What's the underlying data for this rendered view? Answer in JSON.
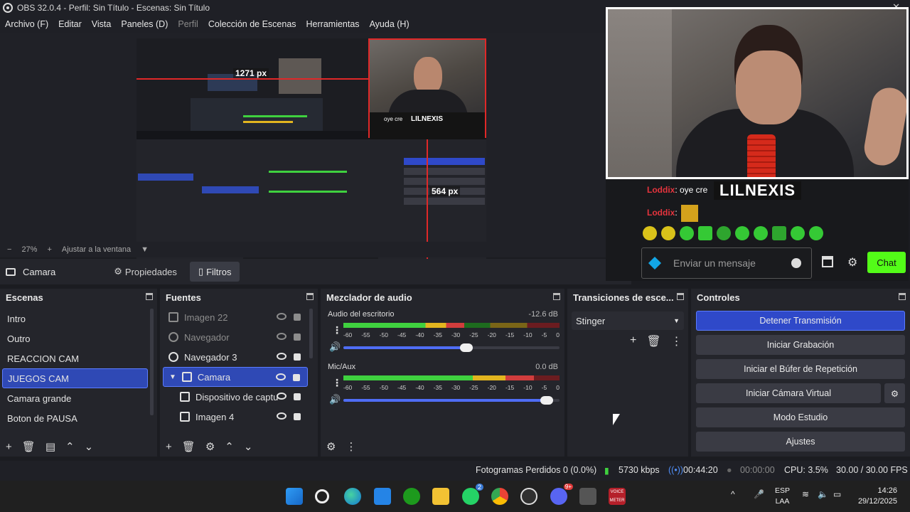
{
  "window": {
    "title": "OBS 32.0.4 - Perfil: Sin Título - Escenas: Sin Título"
  },
  "menu": [
    "Archivo (F)",
    "Editar",
    "Vista",
    "Paneles (D)",
    "Perfil",
    "Colección de Escenas",
    "Herramientas",
    "Ayuda (H)"
  ],
  "preview": {
    "nested_width_label": "1271 px",
    "nested_height_label": "564 px",
    "nested_chat_name": "LILNEXIS",
    "nested_chat_msg": "oye cre"
  },
  "zoom": {
    "minus": "−",
    "value": "27%",
    "plus": "+",
    "fit_label": "Ajustar a la ventana"
  },
  "source_toolbar": {
    "source_name": "Camara",
    "properties_label": "Propiedades",
    "filters_label": "Filtros"
  },
  "overlay": {
    "chat": [
      {
        "user": "Loddix",
        "text": ": oye cre"
      },
      {
        "user": "Loddix",
        "text": ":"
      }
    ],
    "streamer_name": "LILNEXIS",
    "message_placeholder": "Enviar un mensaje",
    "chat_button": "Chat",
    "accent": "#53fc18"
  },
  "scenes": {
    "title": "Escenas",
    "items": [
      "Intro",
      "Outro",
      "REACCION CAM",
      "JUEGOS CAM",
      "Camara grande",
      "Boton de PAUSA"
    ],
    "selected": "JUEGOS CAM"
  },
  "sources": {
    "title": "Fuentes",
    "items": [
      {
        "label": "Imagen 22",
        "icon": "image-icon",
        "visible": false
      },
      {
        "label": "Navegador",
        "icon": "globe-icon",
        "visible": false
      },
      {
        "label": "Navegador 3",
        "icon": "globe-icon",
        "visible": true
      },
      {
        "label": "Camara",
        "icon": "folder-icon",
        "visible": true
      },
      {
        "label": "Dispositivo de captu",
        "icon": "camera-icon",
        "visible": true
      },
      {
        "label": "Imagen 4",
        "icon": "image-icon",
        "visible": true
      }
    ],
    "selected": "Camara"
  },
  "mixer": {
    "title": "Mezclador de audio",
    "scale": [
      "-60",
      "-55",
      "-50",
      "-45",
      "-40",
      "-35",
      "-30",
      "-25",
      "-20",
      "-15",
      "-10",
      "-5",
      "0"
    ],
    "channels": [
      {
        "name": "Audio del escritorio",
        "db": "-12.6 dB",
        "level": 0.56,
        "volume": 0.6
      },
      {
        "name": "Mic/Aux",
        "db": "0.0 dB",
        "level": 0.88,
        "volume": 0.97
      }
    ]
  },
  "transitions": {
    "title": "Transiciones de esce...",
    "selected": "Stinger"
  },
  "controls": {
    "title": "Controles",
    "buttons": [
      "Detener Transmisión",
      "Iniciar Grabación",
      "Iniciar el Búfer de Repetición",
      "Iniciar Cámara Virtual",
      "Modo Estudio",
      "Ajustes"
    ]
  },
  "status": {
    "dropped_frames": "Fotogramas Perdidos 0 (0.0%)",
    "bitrate": "5730 kbps",
    "stream_time": "00:44:20",
    "rec_time": "00:00:00",
    "cpu": "CPU: 3.5%",
    "fps": "30.00 / 30.00 FPS"
  },
  "taskbar": {
    "lang_top": "ESP",
    "lang_bottom": "LAA",
    "time": "14:26",
    "date": "29/12/2025",
    "whatsapp_badge": "2",
    "discord_badge": "9+",
    "voicemeeter_label": "VOICE METER"
  }
}
